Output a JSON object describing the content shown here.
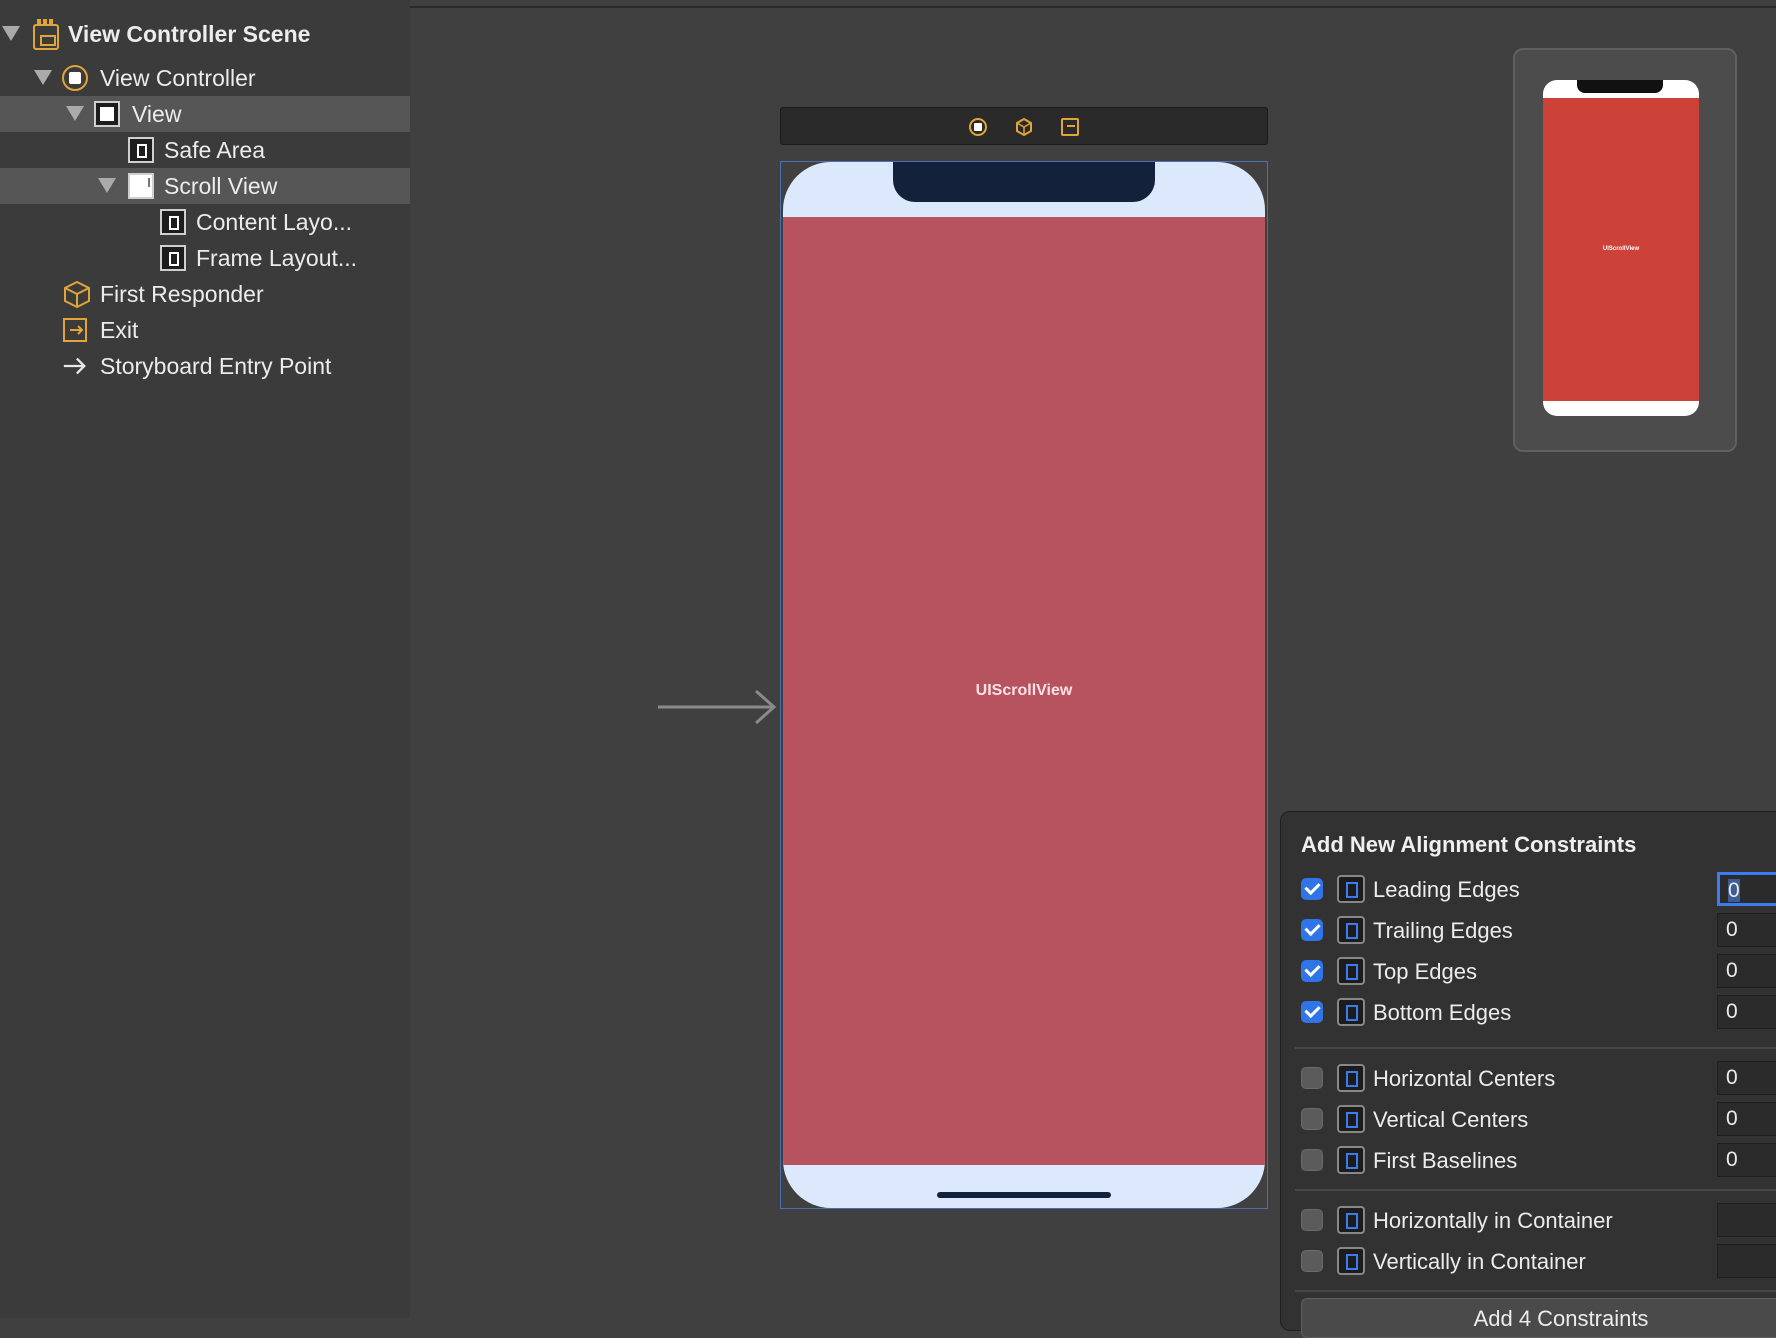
{
  "outline": {
    "items": [
      {
        "label": "View Controller Scene"
      },
      {
        "label": "View Controller"
      },
      {
        "label": "View"
      },
      {
        "label": "Safe Area"
      },
      {
        "label": "Scroll View"
      },
      {
        "label": "Content Layo..."
      },
      {
        "label": "Frame Layout..."
      },
      {
        "label": "First Responder"
      },
      {
        "label": "Exit"
      },
      {
        "label": "Storyboard Entry Point"
      }
    ]
  },
  "canvas": {
    "scroll_view_label": "UIScrollView",
    "scroll_color": "#b6535f",
    "safe_area_color": "#dce8fb"
  },
  "minimap": {
    "label": "UIScrollView",
    "color": "#cd4238"
  },
  "constraints_popover": {
    "title": "Add New Alignment Constraints",
    "rows": [
      {
        "label": "Leading Edges",
        "checked": true,
        "value": "0"
      },
      {
        "label": "Trailing Edges",
        "checked": true,
        "value": "0"
      },
      {
        "label": "Top Edges",
        "checked": true,
        "value": "0"
      },
      {
        "label": "Bottom Edges",
        "checked": true,
        "value": "0"
      },
      {
        "label": "Horizontal Centers",
        "checked": false,
        "value": "0"
      },
      {
        "label": "Vertical Centers",
        "checked": false,
        "value": "0"
      },
      {
        "label": "First Baselines",
        "checked": false,
        "value": "0"
      },
      {
        "label": "Horizontally in Container",
        "checked": false,
        "value": ""
      },
      {
        "label": "Vertically in Container",
        "checked": false,
        "value": ""
      }
    ],
    "add_button_label": "Add 4 Constraints",
    "accent_color": "#2f75e8"
  }
}
